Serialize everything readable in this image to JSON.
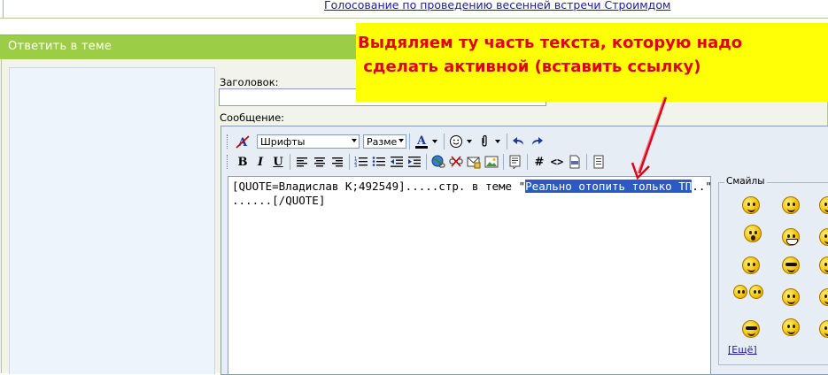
{
  "top_link": "Голосование по проведению весенней встречи Строимдом",
  "panel": {
    "title": "Ответить в теме"
  },
  "form": {
    "subject_label": "Заголовок:",
    "subject_value": "",
    "message_label": "Сообщение:"
  },
  "toolbar": {
    "font_select": "Шрифты",
    "size_select": "Разме",
    "bold": "B",
    "italic": "I",
    "underline": "U",
    "code_hash": "#",
    "code_tags": "<>"
  },
  "editor": {
    "line1_before": "[QUOTE=Владислав К;492549].....стр. в теме \"",
    "line1_selected": "Реально отопить только ТП",
    "line1_after": "..\"",
    "line2": "......[/QUOTE]"
  },
  "smiles": {
    "legend": "Смайлы",
    "more": "[Ещё]"
  },
  "callout": {
    "text": "Выдяляем ту часть текста, которую надо\n сделать активной (вставить ссылку)",
    "bg_color": "#ffff05",
    "text_color": "#e0001a"
  }
}
